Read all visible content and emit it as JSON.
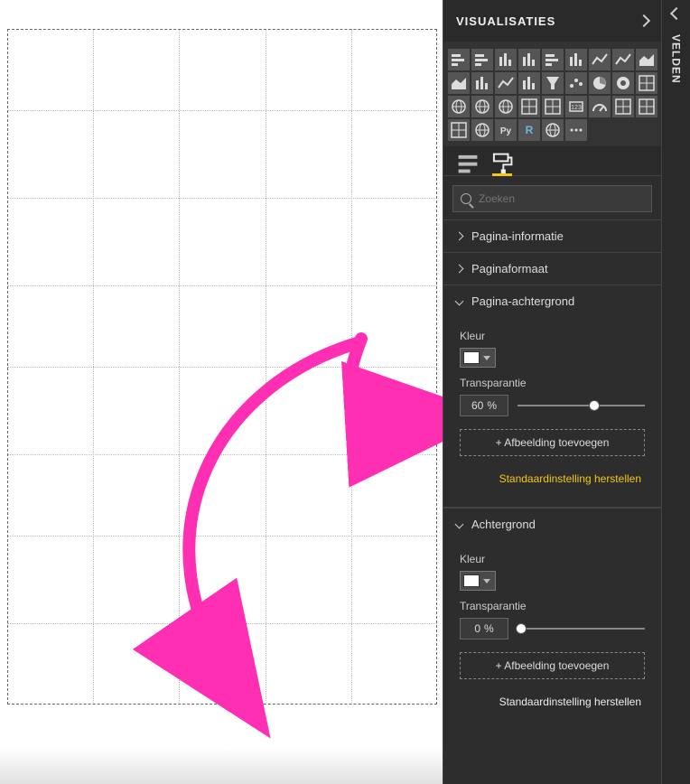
{
  "panels": {
    "visualizations_title": "VISUALISATIES",
    "fields_title": "VELDEN"
  },
  "search": {
    "placeholder": "Zoeken"
  },
  "accordion": {
    "page_info": "Pagina-informatie",
    "page_size": "Paginaformaat",
    "page_background": "Pagina-achtergrond",
    "background": "Achtergrond"
  },
  "labels": {
    "color": "Kleur",
    "transparency": "Transparantie",
    "add_image": "+ Afbeelding toevoegen",
    "reset_default": "Standaardinstelling herstellen",
    "percent": "%"
  },
  "values": {
    "page_bg_color": "#ffffff",
    "page_bg_transparency": "60",
    "bg_color": "#ffffff",
    "bg_transparency": "0"
  },
  "viz_icons": [
    "stacked-bar",
    "clustered-bar",
    "stacked-column",
    "clustered-column",
    "100-stacked-bar",
    "100-stacked-column",
    "ribbon",
    "line",
    "area",
    "stacked-area",
    "line-column",
    "line-clustered",
    "waterfall",
    "funnel",
    "scatter",
    "pie",
    "donut",
    "treemap",
    "map",
    "filled-map",
    "shape-map",
    "matrix",
    "table",
    "kpi",
    "gauge",
    "card",
    "multi-row-card",
    "slicer",
    "arcgis",
    "python",
    "r-script",
    "globe",
    "more"
  ]
}
